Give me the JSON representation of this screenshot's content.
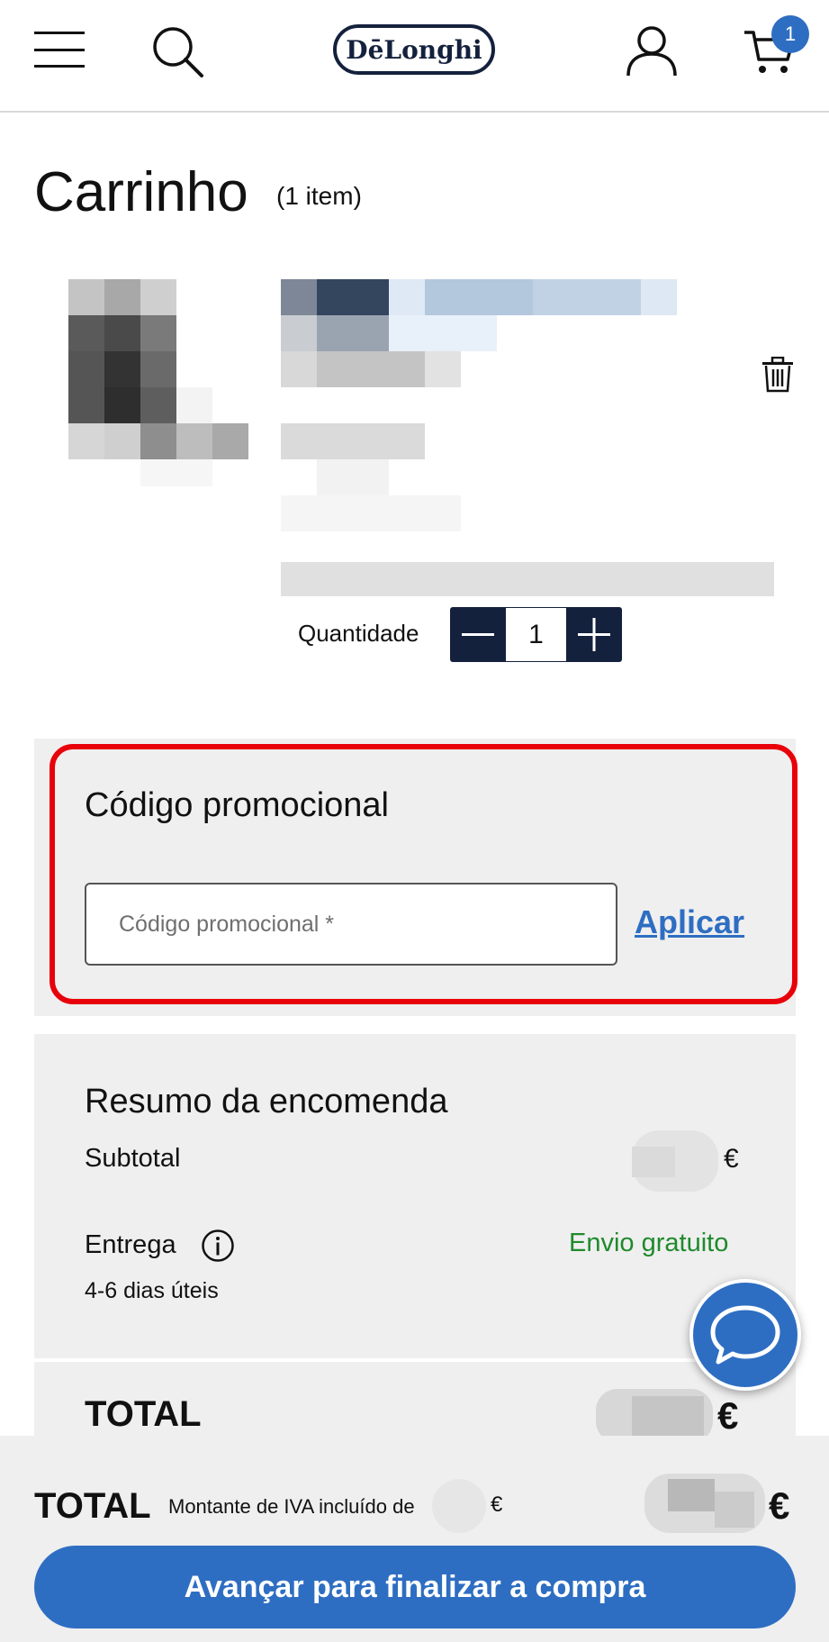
{
  "header": {
    "logo_text": "DēLonghi",
    "cart_count": "1",
    "icons": [
      "menu-icon",
      "search-icon",
      "user-icon",
      "cart-icon"
    ]
  },
  "cart": {
    "title": "Carrinho",
    "item_count": "(1 item)",
    "quantity_label": "Quantidade",
    "quantity_value": "1"
  },
  "promo": {
    "title": "Código promocional",
    "input_placeholder": "Código promocional *",
    "apply_label": "Aplicar"
  },
  "summary": {
    "title": "Resumo da encomenda",
    "subtotal_label": "Subtotal",
    "subtotal_currency": "€",
    "delivery_label": "Entrega",
    "delivery_value": "Envio gratuito",
    "delivery_time": "4-6 dias úteis",
    "total_label": "TOTAL",
    "total_currency": "€"
  },
  "footer": {
    "total_label": "TOTAL",
    "vat_text": "Montante de IVA incluído de",
    "vat_currency": "€",
    "total_currency": "€",
    "checkout_label": "Avançar para finalizar a compra"
  },
  "colors": {
    "brand_navy": "#14213d",
    "accent_blue": "#2e6ec2",
    "highlight_red": "#e8000a",
    "free_green": "#1f8a2c"
  }
}
